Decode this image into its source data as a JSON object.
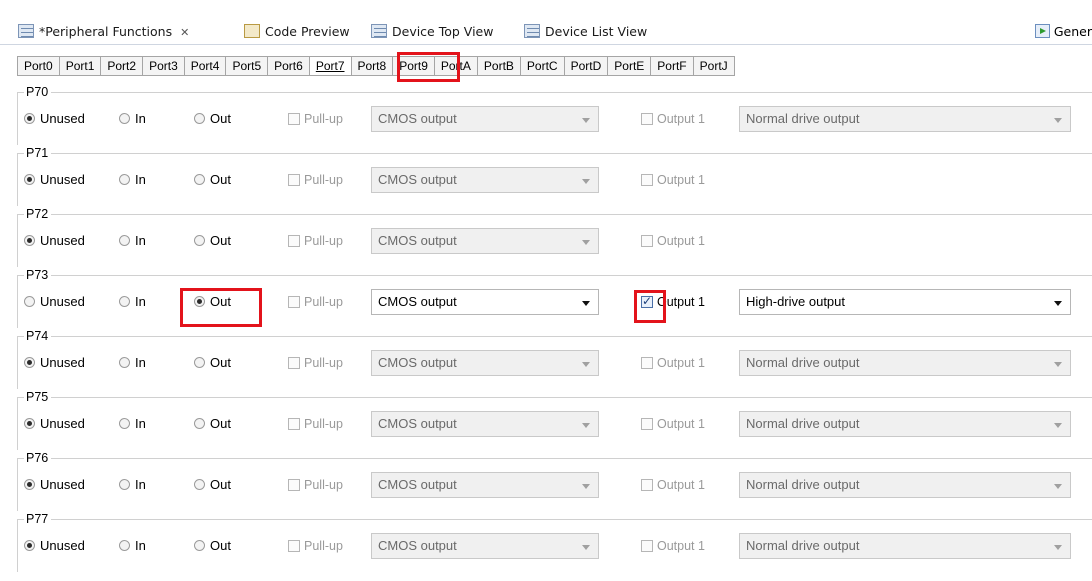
{
  "editor_tabs": [
    {
      "label": "*Peripheral Functions",
      "close": "✕"
    },
    {
      "label": "Code Preview"
    },
    {
      "label": "Device Top View"
    },
    {
      "label": "Device List View"
    }
  ],
  "generate_label": "Gener",
  "port_tabs": [
    "Port0",
    "Port1",
    "Port2",
    "Port3",
    "Port4",
    "Port5",
    "Port6",
    "Port7",
    "Port8",
    "Port9",
    "PortA",
    "PortB",
    "PortC",
    "PortD",
    "PortE",
    "PortF",
    "PortJ"
  ],
  "selected_port": "Port7",
  "labels": {
    "unused": "Unused",
    "in": "In",
    "out": "Out",
    "pullup": "Pull-up",
    "output1": "Output 1"
  },
  "pins": [
    {
      "name": "P70",
      "mode": "Unused",
      "output_type": "CMOS output",
      "output1_checked": false,
      "drive": "Normal drive output"
    },
    {
      "name": "P71",
      "mode": "Unused",
      "output_type": "CMOS output",
      "output1_checked": false,
      "drive": null
    },
    {
      "name": "P72",
      "mode": "Unused",
      "output_type": "CMOS output",
      "output1_checked": false,
      "drive": null
    },
    {
      "name": "P73",
      "mode": "Out",
      "output_type": "CMOS output",
      "output1_checked": true,
      "drive": "High-drive output"
    },
    {
      "name": "P74",
      "mode": "Unused",
      "output_type": "CMOS output",
      "output1_checked": false,
      "drive": "Normal drive output"
    },
    {
      "name": "P75",
      "mode": "Unused",
      "output_type": "CMOS output",
      "output1_checked": false,
      "drive": "Normal drive output"
    },
    {
      "name": "P76",
      "mode": "Unused",
      "output_type": "CMOS output",
      "output1_checked": false,
      "drive": "Normal drive output"
    },
    {
      "name": "P77",
      "mode": "Unused",
      "output_type": "CMOS output",
      "output1_checked": false,
      "drive": "Normal drive output"
    }
  ],
  "colors": {
    "highlight": "#e3131b"
  }
}
